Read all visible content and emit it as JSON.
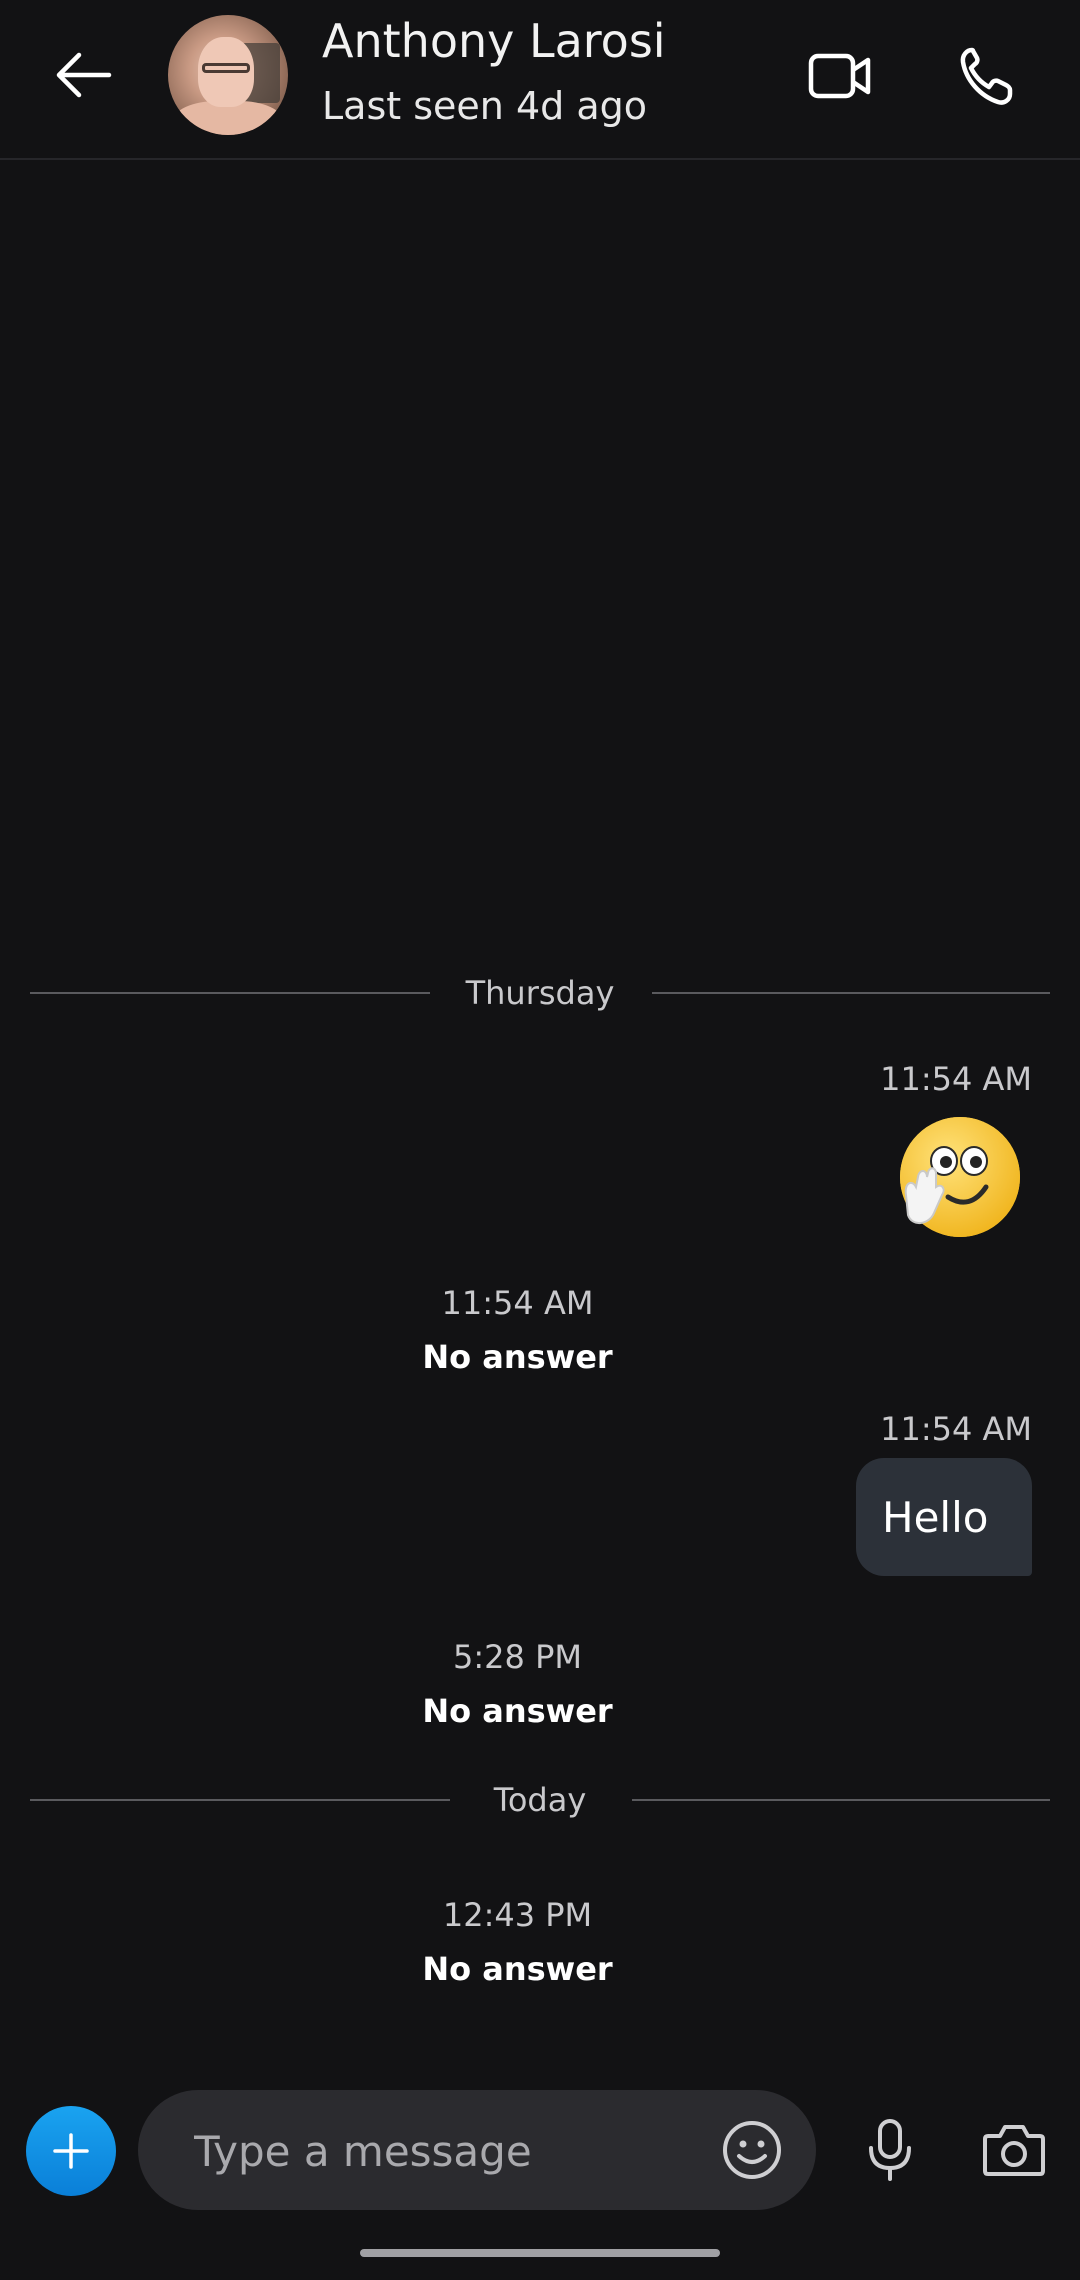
{
  "header": {
    "contact_name": "Anthony Larosi",
    "last_seen": "Last seen 4d ago"
  },
  "conversation": {
    "separators": [
      {
        "label": "Thursday"
      },
      {
        "label": "Today"
      }
    ],
    "messages": [
      {
        "type": "sent_emoji",
        "time": "11:54 AM",
        "emoji": "waving-hand-smiley-emoji"
      },
      {
        "type": "call",
        "time": "11:54 AM",
        "status": "No answer"
      },
      {
        "type": "sent_text",
        "time": "11:54 AM",
        "text": "Hello"
      },
      {
        "type": "call",
        "time": "5:28 PM",
        "status": "No answer"
      },
      {
        "type": "call",
        "time": "12:43 PM",
        "status": "No answer"
      }
    ]
  },
  "composer": {
    "placeholder": "Type a message",
    "value": ""
  },
  "icons": {
    "back": "arrow-left-icon",
    "video": "video-camera-icon",
    "call": "phone-icon",
    "add": "plus-icon",
    "emoji": "smiley-icon",
    "mic": "microphone-icon",
    "camera": "camera-icon"
  },
  "colors": {
    "background": "#121214",
    "bubble": "#2c3139",
    "accent": "#0a8ee0",
    "composer": "#2b2b2f"
  }
}
